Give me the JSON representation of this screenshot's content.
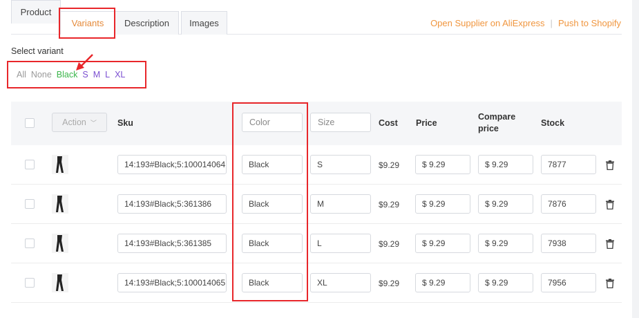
{
  "tabs": [
    {
      "label": "Product",
      "active": false
    },
    {
      "label": "Variants",
      "active": true
    },
    {
      "label": "Description",
      "active": false
    },
    {
      "label": "Images",
      "active": false
    }
  ],
  "top_links": {
    "open_supplier": "Open Supplier on AliExpress",
    "separator": "|",
    "push_shopify": "Push to Shopify"
  },
  "select_variant_label": "Select variant",
  "filters": {
    "all": "All",
    "none": "None",
    "color": "Black",
    "sizes": [
      "S",
      "M",
      "L",
      "XL"
    ]
  },
  "table": {
    "action_label": "Action",
    "headers": {
      "sku": "Sku",
      "color_placeholder": "Color",
      "size_placeholder": "Size",
      "cost": "Cost",
      "price": "Price",
      "compare_price_line1": "Compare",
      "compare_price_line2": "price",
      "stock": "Stock"
    },
    "rows": [
      {
        "sku": "14:193#Black;5:100014064",
        "color": "Black",
        "size": "S",
        "cost": "$9.29",
        "price": "$ 9.29",
        "compare": "$ 9.29",
        "stock": "7877"
      },
      {
        "sku": "14:193#Black;5:361386",
        "color": "Black",
        "size": "M",
        "cost": "$9.29",
        "price": "$ 9.29",
        "compare": "$ 9.29",
        "stock": "7876"
      },
      {
        "sku": "14:193#Black;5:361385",
        "color": "Black",
        "size": "L",
        "cost": "$9.29",
        "price": "$ 9.29",
        "compare": "$ 9.29",
        "stock": "7938"
      },
      {
        "sku": "14:193#Black;5:100014065",
        "color": "Black",
        "size": "XL",
        "cost": "$9.29",
        "price": "$ 9.29",
        "compare": "$ 9.29",
        "stock": "7956"
      }
    ]
  },
  "colors": {
    "accent": "#e58a3a",
    "link": "#f0963f",
    "highlight_red": "#e8262a",
    "filter_green": "#3bb54a",
    "filter_purple": "#7b4fd1"
  },
  "icons": {
    "thumbnail": "leggings-thumbnail",
    "delete": "trash-icon",
    "dropdown": "chevron-down-icon",
    "annotation": "red-arrow-icon"
  }
}
